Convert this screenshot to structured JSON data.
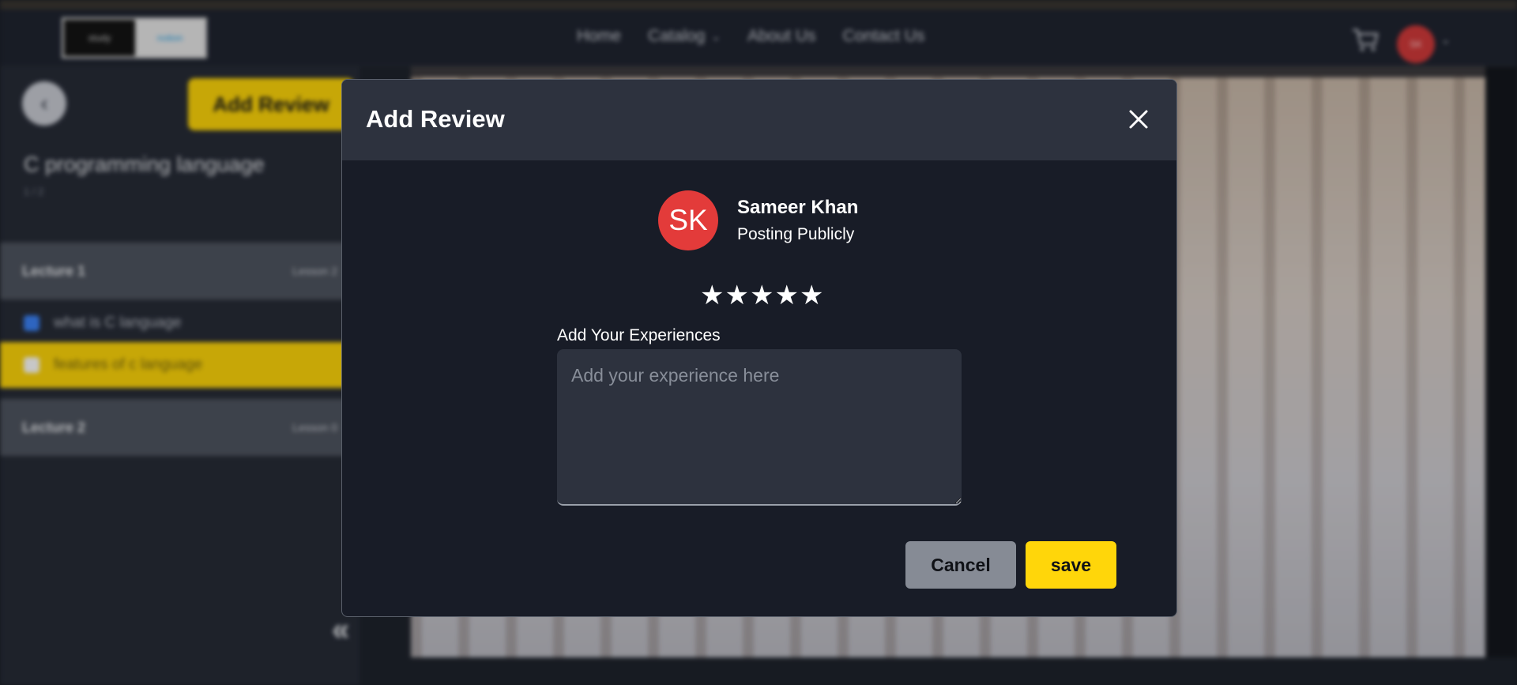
{
  "background": {
    "logo": {
      "left": "study",
      "right": "notion"
    },
    "nav_links": [
      {
        "label": "Home",
        "has_dropdown": false
      },
      {
        "label": "Catalog",
        "has_dropdown": true
      },
      {
        "label": "About Us",
        "has_dropdown": false
      },
      {
        "label": "Contact Us",
        "has_dropdown": false
      }
    ],
    "nav_avatar_initials": "SK",
    "sidebar": {
      "add_review_label": "Add Review",
      "course_title": "C programming language",
      "course_progress": "1 / 2",
      "sections": [
        {
          "title": "Lecture 1",
          "meta": "Lesson 2"
        },
        {
          "title": "Lecture 2",
          "meta": "Lesson 0"
        }
      ],
      "lectures": [
        {
          "title": "what is C language",
          "completed": true
        },
        {
          "title": "features of c language",
          "completed": false,
          "active": true
        }
      ]
    },
    "icons": {
      "back": "arrow-left-icon",
      "cart": "cart-icon",
      "collapse": "double-chevron-left-icon"
    }
  },
  "modal": {
    "title": "Add Review",
    "close_icon": "close-icon",
    "user": {
      "initials": "SK",
      "name": "Sameer Khan",
      "visibility": "Posting Publicly"
    },
    "rating": {
      "max": 5,
      "value": 5,
      "star_glyph": "★"
    },
    "experience": {
      "label": "Add Your Experiences",
      "placeholder": "Add your experience here",
      "value": ""
    },
    "buttons": {
      "cancel": "Cancel",
      "save": "save"
    }
  },
  "colors": {
    "accent_yellow": "#FFD60A",
    "avatar_red": "#E33B3A",
    "modal_bg": "#181C27",
    "modal_header_bg": "#2D323E",
    "cancel_gray": "#868B95"
  }
}
